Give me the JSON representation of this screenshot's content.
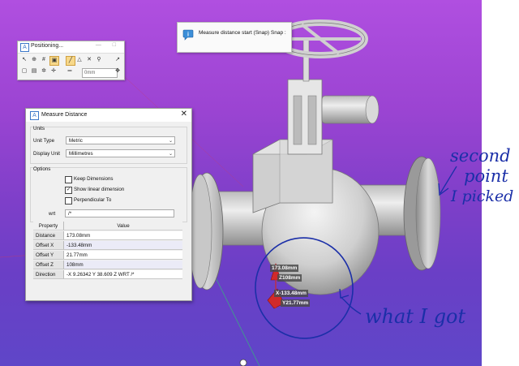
{
  "notification": {
    "text": "Measure distance start (Snap) Snap :"
  },
  "positioning_toolbar": {
    "title": "Positioning...",
    "offset_value": "0mm"
  },
  "measure_dialog": {
    "title": "Measure Distance",
    "units_group": "Units",
    "unit_type_label": "Unit Type",
    "unit_type_value": "Metric",
    "display_unit_label": "Display Unit",
    "display_unit_value": "Millimetres",
    "options_group": "Options",
    "keep_dimensions_label": "Keep Dimensions",
    "keep_dimensions_checked": false,
    "show_linear_label": "Show linear dimension",
    "show_linear_checked": true,
    "perpendicular_label": "Perpendicular To",
    "perpendicular_checked": false,
    "wrt_label": "wrt",
    "wrt_value": "/*",
    "table_headers": {
      "property": "Property",
      "value": "Value"
    },
    "rows": [
      {
        "property": "Distance",
        "value": "173.08mm"
      },
      {
        "property": "Offset X",
        "value": "-133.48mm"
      },
      {
        "property": "Offset Y",
        "value": "21.77mm"
      },
      {
        "property": "Offset Z",
        "value": "108mm"
      },
      {
        "property": "Direction",
        "value": "-X 9.26342 Y 38.609 Z WRT /*"
      }
    ]
  },
  "viewport_tags": {
    "distance": "173.08mm",
    "z": "Z108mm",
    "x": "X-133.48mm",
    "y": "Y21.77mm"
  },
  "annotations": {
    "line1": "second",
    "line2": "point",
    "line3": "I picked",
    "what_i_got": "what I got"
  },
  "colors": {
    "viewport_top": "#b04fe0",
    "viewport_bottom": "#5f46c8",
    "annotation_ink": "#1b2fa8",
    "marker_red": "#d12a2a"
  }
}
